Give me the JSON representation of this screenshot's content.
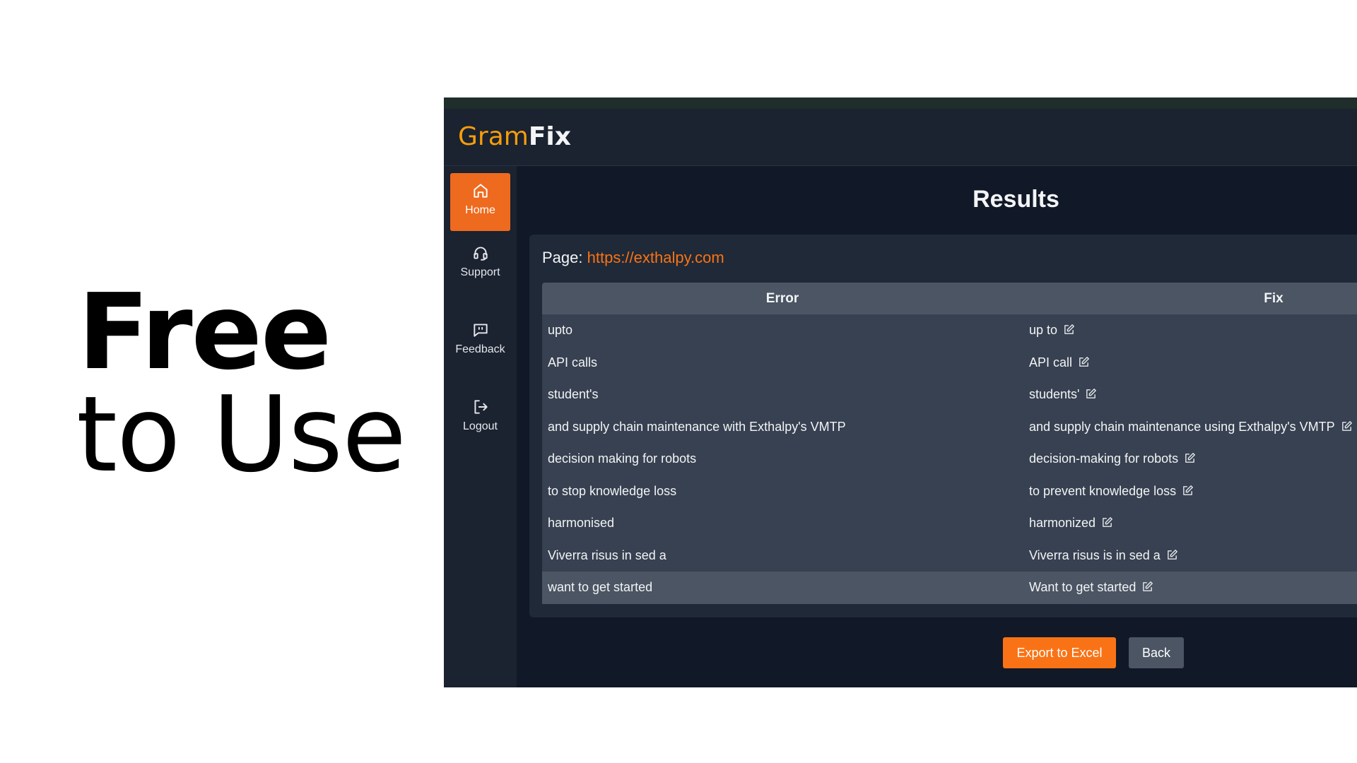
{
  "promo": {
    "line1": "Free",
    "line2": "to Use"
  },
  "app": {
    "logo": {
      "g": "G",
      "ram": "ram",
      "fix": "Fix"
    },
    "sidebar": [
      {
        "label": "Home",
        "icon": "home-icon",
        "active": true
      },
      {
        "label": "Support",
        "icon": "headset-icon",
        "active": false
      },
      {
        "label": "Feedback",
        "icon": "feedback-icon",
        "active": false
      },
      {
        "label": "Logout",
        "icon": "logout-icon",
        "active": false
      }
    ],
    "title": "Results",
    "page": {
      "label": "Page:",
      "url": "https://exthalpy.com"
    },
    "table": {
      "headers": {
        "error": "Error",
        "fix": "Fix"
      },
      "rows": [
        {
          "error": "upto",
          "fix": "up to"
        },
        {
          "error": "API calls",
          "fix": "API call"
        },
        {
          "error": "student's",
          "fix": "students'"
        },
        {
          "error": "and supply chain maintenance with Exthalpy's VMTP",
          "fix": "and supply chain maintenance using Exthalpy's VMTP"
        },
        {
          "error": "decision making for robots",
          "fix": "decision-making for robots"
        },
        {
          "error": "to stop knowledge loss",
          "fix": "to prevent knowledge loss"
        },
        {
          "error": "harmonised",
          "fix": "harmonized"
        },
        {
          "error": "Viverra risus in sed a",
          "fix": "Viverra risus is in sed a"
        },
        {
          "error": "want to get started",
          "fix": "Want to get started"
        }
      ]
    },
    "buttons": {
      "export": "Export to Excel",
      "back": "Back"
    },
    "colors": {
      "accent": "#f97316",
      "background": "#111827",
      "panel": "#1f2937"
    }
  }
}
